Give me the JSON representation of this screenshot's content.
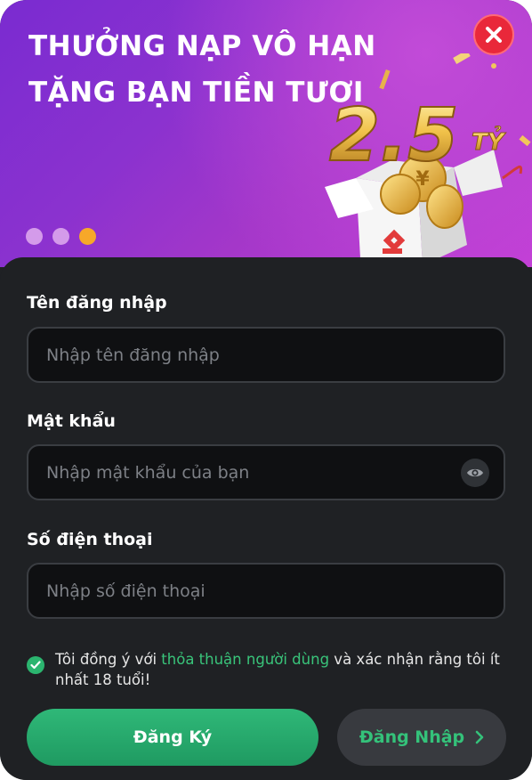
{
  "banner": {
    "title_line1": "THƯỞNG NẠP VÔ HẠN",
    "title_line2": "TẶNG BẠN TIỀN TƯƠI",
    "promo_amount": "2.5",
    "promo_unit": "TỶ",
    "slides": [
      {
        "active": false
      },
      {
        "active": false
      },
      {
        "active": true
      }
    ],
    "colors": {
      "dot": "#d49bea",
      "dot_active": "#f7a829",
      "close": "#e9283a"
    }
  },
  "form": {
    "username": {
      "label": "Tên đăng nhập",
      "placeholder": "Nhập tên đăng nhập",
      "value": ""
    },
    "password": {
      "label": "Mật khẩu",
      "placeholder": "Nhập mật khẩu của bạn",
      "value": "",
      "toggle_icon": "eye-icon"
    },
    "phone": {
      "label": "Số điện thoại",
      "placeholder": "Nhập số điện thoại",
      "value": ""
    },
    "agreement": {
      "checked": true,
      "prefix": "Tôi đồng ý với ",
      "link": "thỏa thuận người dùng",
      "suffix": " và xác nhận rằng tôi ít nhất 18 tuổi!"
    }
  },
  "actions": {
    "register_label": "Đăng Ký",
    "login_label": "Đăng Nhập",
    "accent": "#2fb878"
  }
}
